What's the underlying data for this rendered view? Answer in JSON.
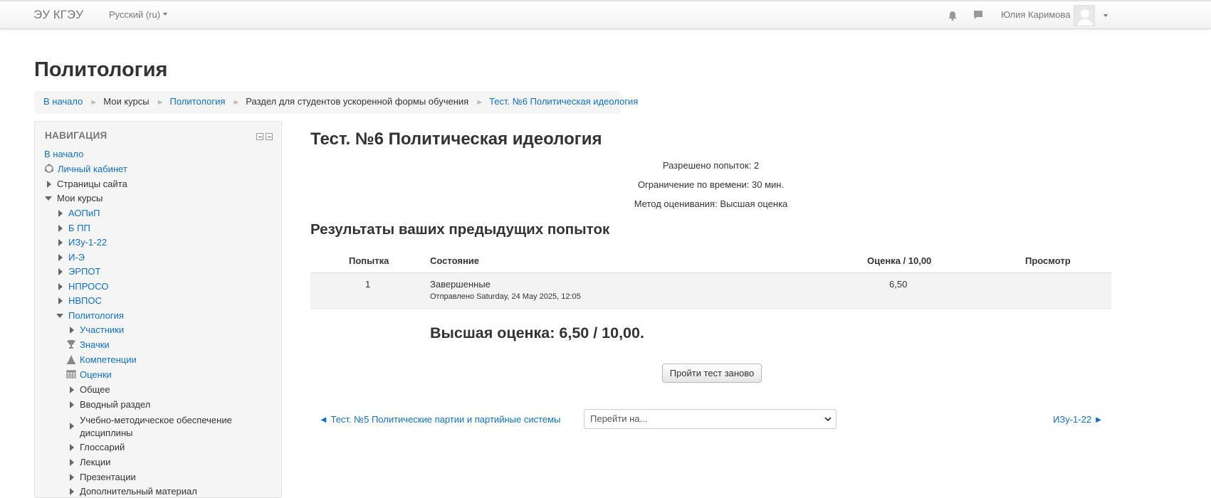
{
  "navbar": {
    "brand": "ЭУ КГЭУ",
    "language": "Русский (ru)",
    "user_name": "Юлия Каримова",
    "icons": [
      "bell-icon",
      "chat-icon",
      "avatar"
    ]
  },
  "page": {
    "title": "Политология"
  },
  "breadcrumb": [
    {
      "label": "В начало",
      "link": true
    },
    {
      "label": "Мои курсы",
      "link": false
    },
    {
      "label": "Политология",
      "link": true
    },
    {
      "label": "Раздел для студентов ускоренной формы обучения",
      "link": false
    },
    {
      "label": "Тест. №6 Политическая идеология",
      "link": true
    }
  ],
  "navigation": {
    "title": "НАВИГАЦИЯ",
    "home": "В начало",
    "dashboard": "Личный кабинет",
    "site_pages": "Страницы сайта",
    "my_courses": "Мои курсы",
    "courses": [
      "АОПиП",
      "Б ПП",
      "ИЗу-1-22",
      "И-Э",
      "ЭРПОТ",
      "НПРОСО",
      "НВПОС"
    ],
    "current_course": "Политология",
    "course_items": {
      "participants": "Участники",
      "badges": "Значки",
      "competencies": "Компетенции",
      "grades": "Оценки",
      "general": "Общее",
      "intro": "Вводный раздел",
      "methodical_1": "Учебно-методическое обеспечение",
      "methodical_2": "дисциплины",
      "glossary": "Глоссарий",
      "lectures": "Лекции",
      "presentations": "Презентации",
      "extra": "Дополнительный материал"
    }
  },
  "quiz": {
    "title": "Тест. №6 Политическая идеология",
    "attempts_allowed": "Разрешено попыток: 2",
    "time_limit": "Ограничение по времени: 30 мин.",
    "grading_method": "Метод оценивания: Высшая оценка",
    "results_title": "Результаты ваших предыдущих попыток",
    "table": {
      "headers": {
        "attempt": "Попытка",
        "state": "Состояние",
        "grade": "Оценка / 10,00",
        "review": "Просмотр"
      },
      "rows": [
        {
          "attempt": "1",
          "state": "Завершенные",
          "submitted": "Отправлено Saturday, 24 May 2025, 12:05",
          "grade": "6,50",
          "review": ""
        }
      ]
    },
    "best_grade": "Высшая оценка: 6,50 / 10,00.",
    "retry_button": "Пройти тест заново",
    "prev_link": "◄ Тест. №5 Политические партии и партийные системы",
    "jump_placeholder": "Перейти на...",
    "next_link": "ИЗу-1-22 ►"
  },
  "colors": {
    "link": "#0f6fc5",
    "text": "#333333",
    "muted": "#777777",
    "panel": "#f5f5f5"
  }
}
